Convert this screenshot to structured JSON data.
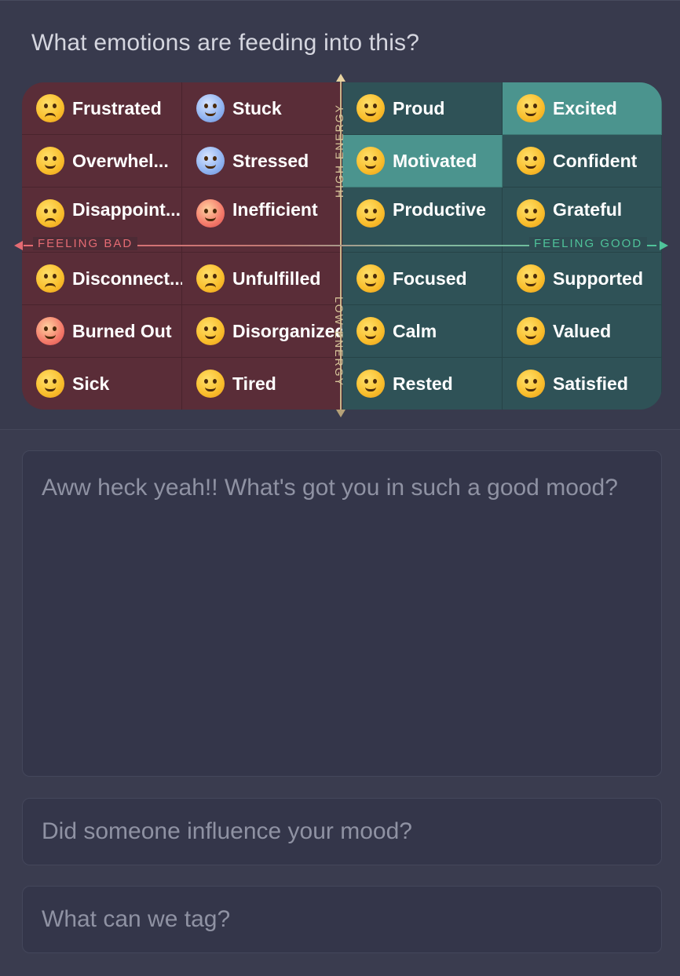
{
  "prompt": "What emotions are feeding into this?",
  "axes": {
    "high": "HIGH ENERGY",
    "low": "LOW ENERGY",
    "bad": "FEELING BAD",
    "good": "FEELING GOOD",
    "bad_color": "#e56b73",
    "good_color": "#4fc39a"
  },
  "emotions": [
    {
      "label": "Frustrated",
      "icon": "frustrated-face-icon"
    },
    {
      "label": "Stuck",
      "icon": "cold-face-icon"
    },
    {
      "label": "Proud",
      "icon": "smiling-face-icon"
    },
    {
      "label": "Excited",
      "icon": "star-struck-face-icon",
      "selected": true
    },
    {
      "label": "Overwhel...",
      "icon": "tired-face-icon"
    },
    {
      "label": "Stressed",
      "icon": "fearful-face-icon"
    },
    {
      "label": "Motivated",
      "icon": "grinning-face-icon",
      "selected": true
    },
    {
      "label": "Confident",
      "icon": "sunglasses-face-icon"
    },
    {
      "label": "Disappoint...",
      "icon": "disappointed-face-icon"
    },
    {
      "label": "Inefficient",
      "icon": "dizzy-face-icon"
    },
    {
      "label": "Productive",
      "icon": "beaming-face-icon"
    },
    {
      "label": "Grateful",
      "icon": "heart-eyes-face-icon"
    },
    {
      "label": "Disconnect...",
      "icon": "pleading-face-icon"
    },
    {
      "label": "Unfulfilled",
      "icon": "frowning-face-icon"
    },
    {
      "label": "Focused",
      "icon": "monocle-face-icon"
    },
    {
      "label": "Supported",
      "icon": "smiling-hearts-face-icon"
    },
    {
      "label": "Burned Out",
      "icon": "hot-face-icon"
    },
    {
      "label": "Disorganized",
      "icon": "woozy-face-icon"
    },
    {
      "label": "Calm",
      "icon": "relieved-face-icon"
    },
    {
      "label": "Valued",
      "icon": "hugging-face-icon"
    },
    {
      "label": "Sick",
      "icon": "sneezing-face-icon"
    },
    {
      "label": "Tired",
      "icon": "yawning-face-icon"
    },
    {
      "label": "Rested",
      "icon": "content-face-icon"
    },
    {
      "label": "Satisfied",
      "icon": "yum-face-icon"
    }
  ],
  "journal": {
    "placeholder": "Aww heck yeah!! What's got you in such a good mood?"
  },
  "influence": {
    "placeholder": "Did someone influence your mood?"
  },
  "tag": {
    "placeholder": "What can we tag?"
  }
}
